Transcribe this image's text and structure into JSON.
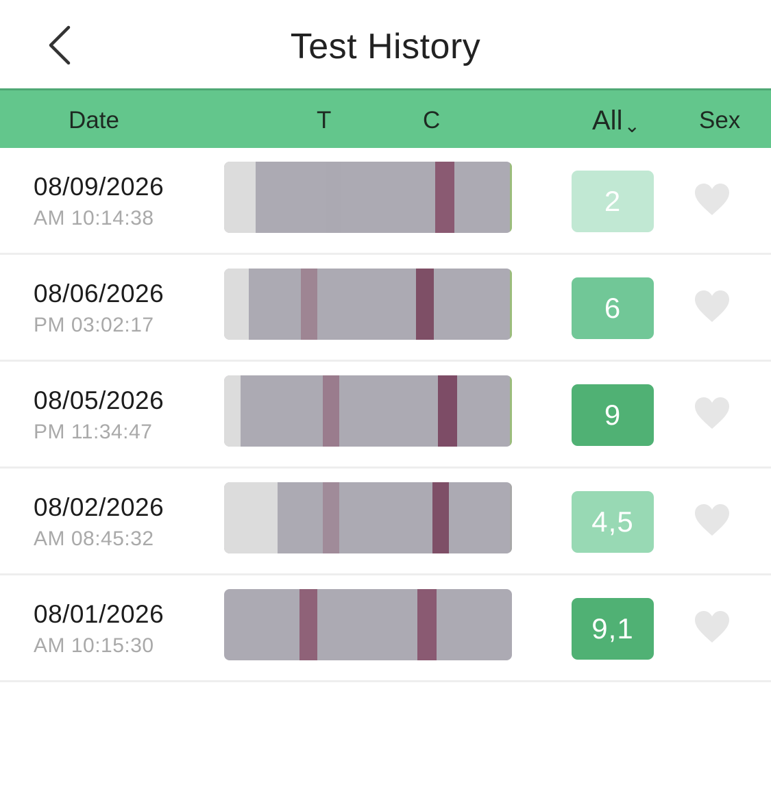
{
  "nav": {
    "title": "Test History"
  },
  "header": {
    "date": "Date",
    "t": "T",
    "c": "C",
    "filter": "All",
    "sex": "Sex"
  },
  "colors": {
    "header_bg": "#63c68c",
    "heart": "#e6e6e6"
  },
  "records": [
    {
      "date": "08/09/2026",
      "time": "AM 10:14:38",
      "result": "2",
      "badge_color": "#c1e8d3"
    },
    {
      "date": "08/06/2026",
      "time": "PM 03:02:17",
      "result": "6",
      "badge_color": "#71c797"
    },
    {
      "date": "08/05/2026",
      "time": "PM 11:34:47",
      "result": "9",
      "badge_color": "#50b174"
    },
    {
      "date": "08/02/2026",
      "time": "AM 08:45:32",
      "result": "4,5",
      "badge_color": "#98d9b4"
    },
    {
      "date": "08/01/2026",
      "time": "AM 10:15:30",
      "result": "9,1",
      "badge_color": "#50b174"
    }
  ]
}
